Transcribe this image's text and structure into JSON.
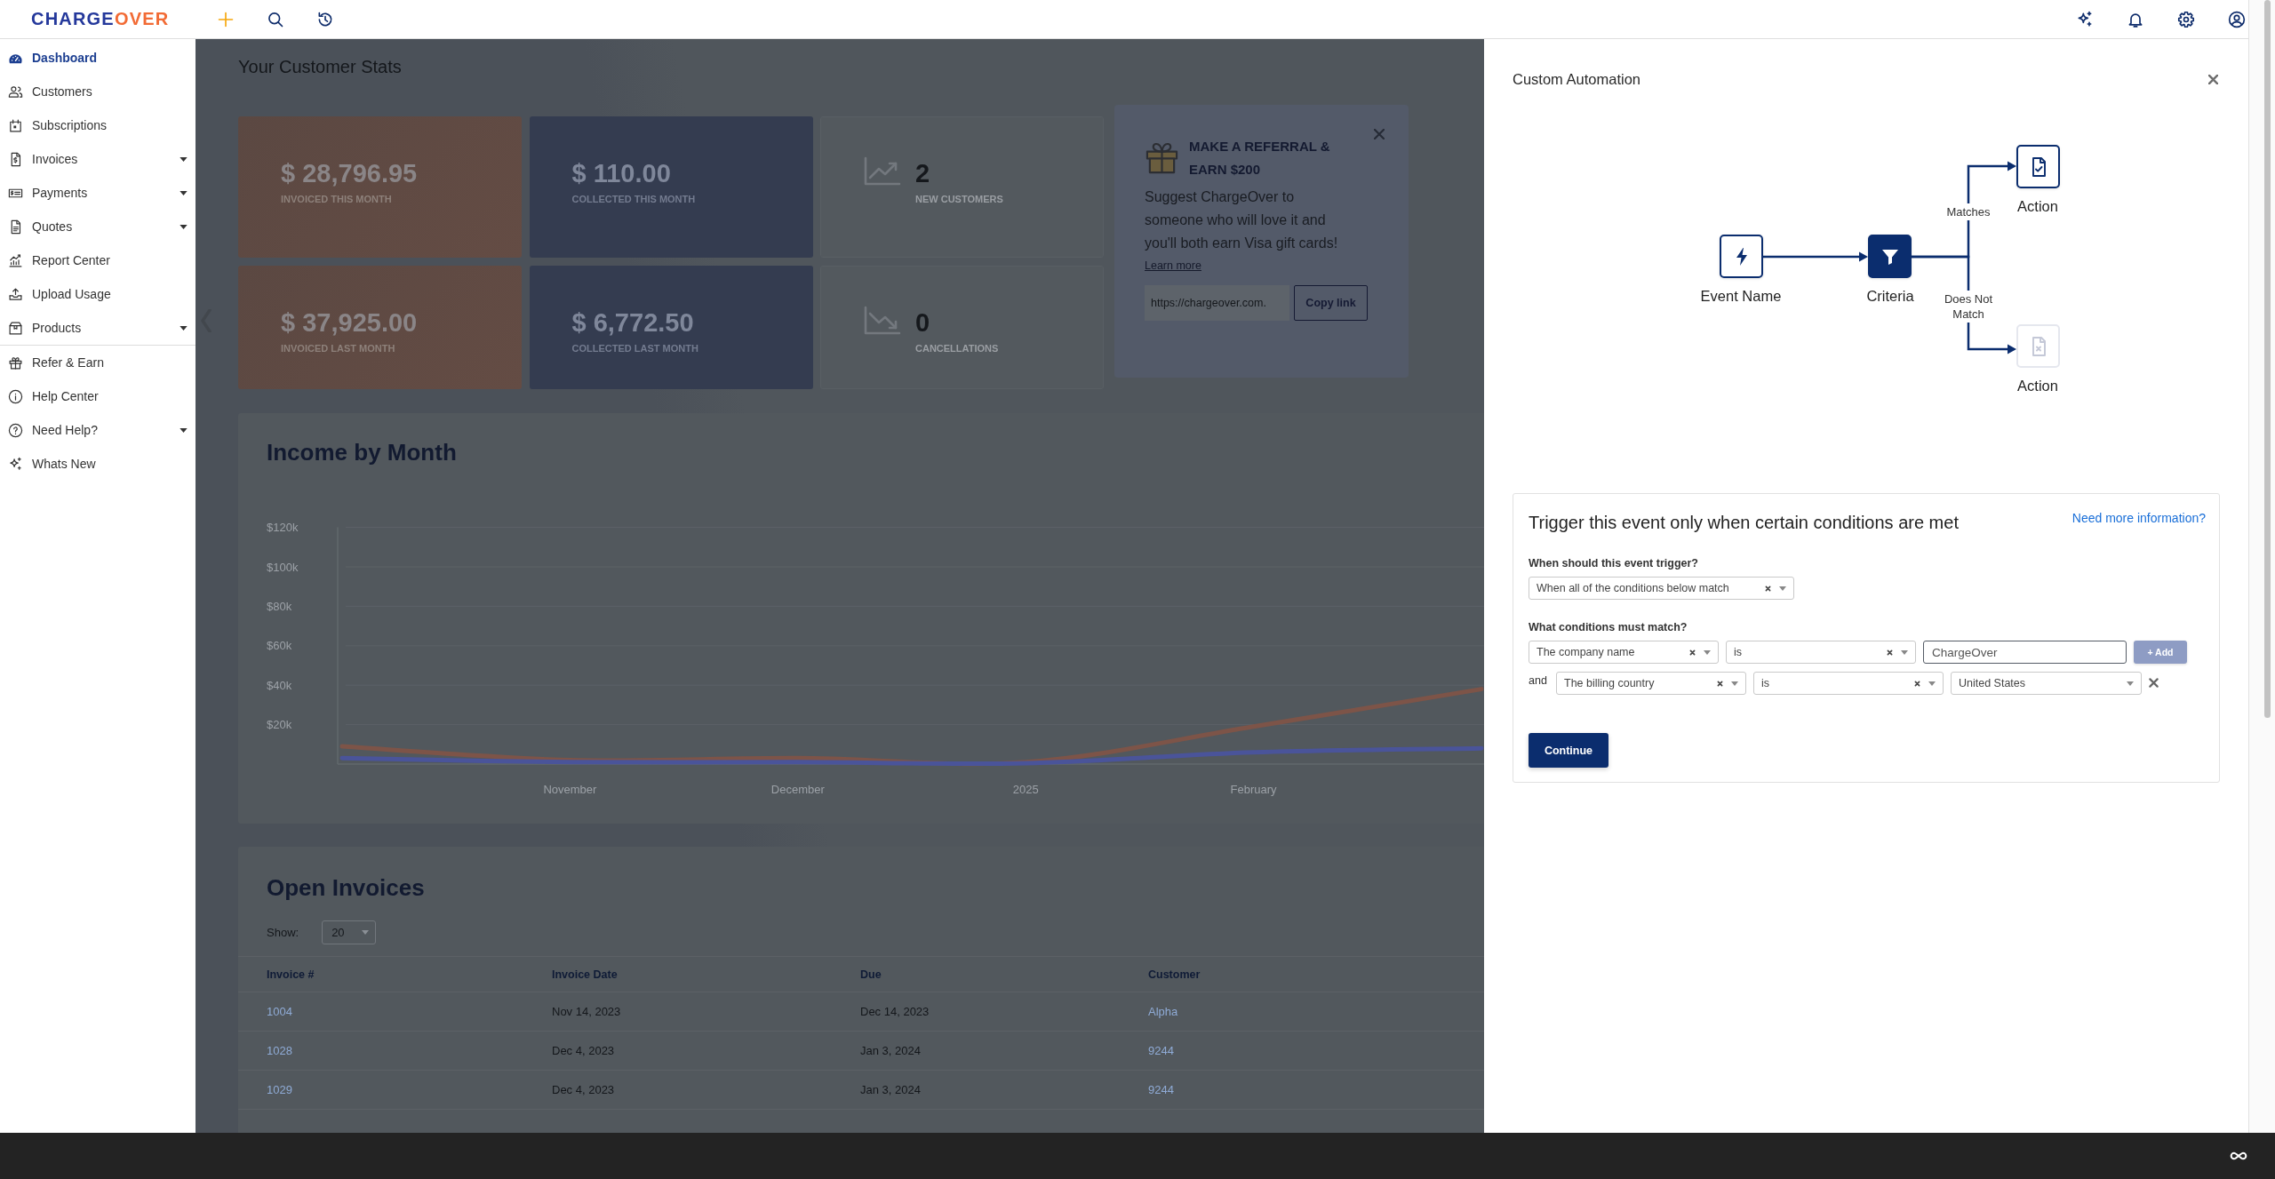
{
  "topbar": {
    "logo": {
      "words": [
        "CHARGE",
        "OVER"
      ]
    }
  },
  "sidebar": {
    "groups": [
      {
        "items": [
          {
            "label": "Dashboard",
            "selected": true,
            "has_submenu": false
          },
          {
            "label": "Customers",
            "selected": false,
            "has_submenu": false
          },
          {
            "label": "Subscriptions",
            "selected": false,
            "has_submenu": false
          },
          {
            "label": "Invoices",
            "selected": false,
            "has_submenu": true
          },
          {
            "label": "Payments",
            "selected": false,
            "has_submenu": true
          },
          {
            "label": "Quotes",
            "selected": false,
            "has_submenu": true
          },
          {
            "label": "Report Center",
            "selected": false,
            "has_submenu": false
          },
          {
            "label": "Upload Usage",
            "selected": false,
            "has_submenu": false
          },
          {
            "label": "Products",
            "selected": false,
            "has_submenu": true
          }
        ]
      },
      {
        "items": [
          {
            "label": "Refer & Earn",
            "selected": false,
            "has_submenu": false
          },
          {
            "label": "Help Center",
            "selected": false,
            "has_submenu": false
          },
          {
            "label": "Need Help?",
            "selected": false,
            "has_submenu": true
          },
          {
            "label": "Whats New",
            "selected": false,
            "has_submenu": false
          }
        ]
      }
    ]
  },
  "dashboard": {
    "heading": "Your Customer Stats",
    "stats": [
      {
        "kind": "invoiced",
        "amount": "$ 28,796.95",
        "label": "INVOICED THIS MONTH"
      },
      {
        "kind": "collected",
        "amount": "$ 110.00",
        "label": "COLLECTED THIS MONTH"
      },
      {
        "kind": "growth",
        "amount": "2",
        "label": "NEW CUSTOMERS"
      },
      {
        "kind": "invoiced",
        "amount": "$ 37,925.00",
        "label": "INVOICED LAST MONTH"
      },
      {
        "kind": "collected",
        "amount": "$ 6,772.50",
        "label": "COLLECTED LAST MONTH"
      },
      {
        "kind": "loss",
        "amount": "0",
        "label": "CANCELLATIONS"
      }
    ],
    "referral": {
      "title": "MAKE A REFERRAL & EARN $200",
      "text": "Suggest ChargeOver to someone who will love it and you'll both earn Visa gift cards!",
      "link": "Learn more",
      "url": {
        "value": "https://chargeover.com."
      },
      "button": "Copy link"
    },
    "income": {
      "chart_data": {
        "type": "line",
        "title": "Income by Month",
        "grid": true,
        "categories": [
          null,
          "November",
          "December",
          "2025",
          "February",
          null
        ],
        "ylim": [
          0,
          120000
        ],
        "yticks": [
          {
            "value": 120000,
            "label": "$120k"
          },
          {
            "value": 100000,
            "label": "$100k"
          },
          {
            "value": 80000,
            "label": "$80k"
          },
          {
            "value": 60000,
            "label": "$60k"
          },
          {
            "value": 40000,
            "label": "$40k"
          },
          {
            "value": 20000,
            "label": "$20k"
          }
        ],
        "series": [
          {
            "color": "#7d5448",
            "values": [
              9000,
              2000,
              3000,
              1000,
              19000,
              38000
            ]
          },
          {
            "color": "#4a549a",
            "values": [
              3000,
              1000,
              1000,
              500,
              6000,
              8000
            ]
          }
        ]
      }
    },
    "open_invoices": {
      "title": "Open Invoices",
      "show_label": "Show:",
      "page_size": {
        "value": "20"
      },
      "columns": [
        "Invoice #",
        "Invoice Date",
        "Due",
        "Customer"
      ],
      "rows": [
        [
          "1004",
          "Nov 14, 2023",
          "Dec 14, 2023",
          "Alpha"
        ],
        [
          "1028",
          "Dec 4, 2023",
          "Jan 3, 2024",
          "9244"
        ],
        [
          "1029",
          "Dec 4, 2023",
          "Jan 3, 2024",
          "9244"
        ]
      ]
    }
  },
  "drawer": {
    "title": "Custom Automation",
    "diagram": {
      "nodes": [
        {
          "kind": "event",
          "label": "Event Name",
          "selected": false,
          "disabled": false
        },
        {
          "kind": "filter",
          "label": "Criteria",
          "selected": true,
          "disabled": false
        },
        {
          "kind": "match_action",
          "label": "Action",
          "selected": false,
          "disabled": false
        },
        {
          "kind": "nomatch_action",
          "label": "Action",
          "selected": false,
          "disabled": true
        }
      ],
      "branches": [
        {
          "label": "Matches"
        },
        {
          "label": "Does Not Match"
        }
      ]
    },
    "criteria": {
      "title": "Trigger this event only when certain conditions are met",
      "help_link": "Need more information?",
      "trigger": {
        "label": "When should this event trigger?",
        "select": {
          "value": "When all of the conditions below match",
          "clearable": true
        }
      },
      "conditions": {
        "label": "What conditions must match?",
        "rows": [
          {
            "field": {
              "value": "The company name",
              "clearable": true
            },
            "operator": {
              "value": "is",
              "clearable": true
            },
            "value": {
              "kind": "text",
              "value": "ChargeOver"
            },
            "action": {
              "kind": "add",
              "label": "+ Add",
              "disabled": true
            }
          },
          {
            "prefix": "and",
            "field": {
              "value": "The billing country",
              "clearable": true
            },
            "operator": {
              "value": "is",
              "clearable": true
            },
            "value": {
              "kind": "select",
              "value": "United States",
              "clearable": false
            },
            "action": {
              "kind": "remove"
            }
          }
        ]
      },
      "continue_button": "Continue"
    }
  }
}
